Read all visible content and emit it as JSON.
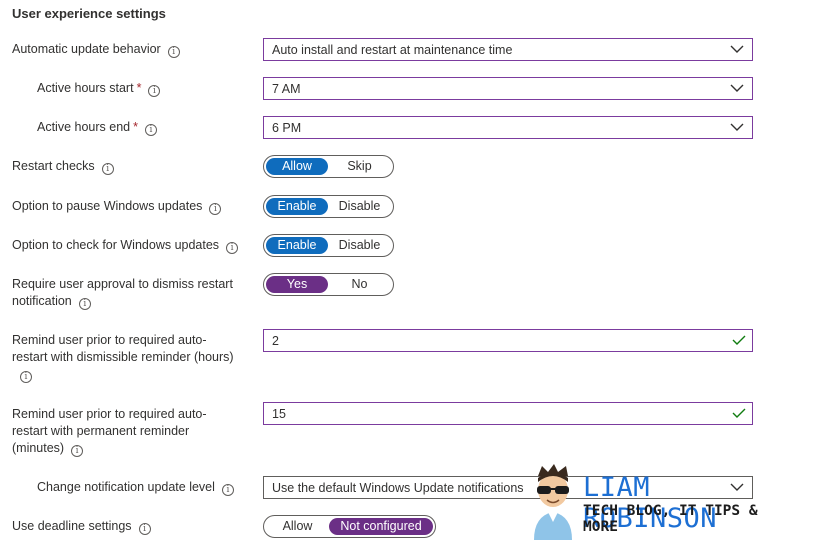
{
  "section": {
    "title": "User experience settings"
  },
  "rows": {
    "auto_update": {
      "label": "Automatic update behavior",
      "value": "Auto install and restart at maintenance time"
    },
    "active_start": {
      "label": "Active hours start",
      "required": "*",
      "value": "7 AM"
    },
    "active_end": {
      "label": "Active hours end",
      "required": "*",
      "value": "6 PM"
    },
    "restart_checks": {
      "label": "Restart checks",
      "options": [
        "Allow",
        "Skip"
      ],
      "selected": "Allow"
    },
    "pause_updates": {
      "label": "Option to pause Windows updates",
      "options": [
        "Enable",
        "Disable"
      ],
      "selected": "Enable"
    },
    "check_updates": {
      "label": "Option to check for Windows updates",
      "options": [
        "Enable",
        "Disable"
      ],
      "selected": "Enable"
    },
    "require_approval": {
      "label_line1": "Require user approval to dismiss restart",
      "label_line2": "notification",
      "options": [
        "Yes",
        "No"
      ],
      "selected": "Yes"
    },
    "remind_dismissible": {
      "label_line1": "Remind user prior to required auto-",
      "label_line2": "restart with dismissible reminder (hours)",
      "value": "2"
    },
    "remind_permanent": {
      "label_line1": "Remind user prior to required auto-",
      "label_line2": "restart with permanent reminder",
      "label_line3": "(minutes)",
      "value": "15"
    },
    "notification_level": {
      "label": "Change notification update level",
      "value": "Use the default Windows Update notifications"
    },
    "deadline": {
      "label": "Use deadline settings",
      "options": [
        "Allow",
        "Not configured"
      ],
      "selected": "Not configured"
    }
  },
  "icons": {
    "info": "info-icon",
    "chevron": "chevron-down-icon",
    "check": "checkmark-icon"
  },
  "colors": {
    "accent_blue": "#0f6cbd",
    "accent_purple": "#6b2f86",
    "field_border": "#7b3b9e",
    "valid_green": "#107c10",
    "required_red": "#a4262c"
  },
  "watermark": {
    "name": "LIAM ROBINSON",
    "tagline": "TECH BLOG, IT TIPS & MORE"
  }
}
